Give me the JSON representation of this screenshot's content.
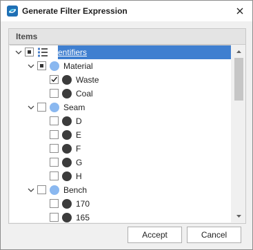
{
  "window": {
    "title": "Generate Filter Expression"
  },
  "group": {
    "title": "Items"
  },
  "tree": {
    "items": [
      {
        "label": "Identifiers",
        "level": 0,
        "expanded": true,
        "check": "indeterminate",
        "icon": "list-icon",
        "selected": true
      },
      {
        "label": "Material",
        "level": 1,
        "expanded": true,
        "check": "indeterminate",
        "icon": "blue-circle"
      },
      {
        "label": "Waste",
        "level": 2,
        "check": "checked",
        "icon": "dark-circle"
      },
      {
        "label": "Coal",
        "level": 2,
        "check": "unchecked",
        "icon": "dark-circle"
      },
      {
        "label": "Seam",
        "level": 1,
        "expanded": true,
        "check": "unchecked",
        "icon": "blue-circle"
      },
      {
        "label": "D",
        "level": 2,
        "check": "unchecked",
        "icon": "dark-circle"
      },
      {
        "label": "E",
        "level": 2,
        "check": "unchecked",
        "icon": "dark-circle"
      },
      {
        "label": "F",
        "level": 2,
        "check": "unchecked",
        "icon": "dark-circle"
      },
      {
        "label": "G",
        "level": 2,
        "check": "unchecked",
        "icon": "dark-circle"
      },
      {
        "label": "H",
        "level": 2,
        "check": "unchecked",
        "icon": "dark-circle"
      },
      {
        "label": "Bench",
        "level": 1,
        "expanded": true,
        "check": "unchecked",
        "icon": "blue-circle"
      },
      {
        "label": "170",
        "level": 2,
        "check": "unchecked",
        "icon": "dark-circle"
      },
      {
        "label": "165",
        "level": 2,
        "check": "unchecked",
        "icon": "dark-circle"
      }
    ]
  },
  "buttons": {
    "accept": "Accept",
    "cancel": "Cancel"
  },
  "colors": {
    "selection": "#3f7fd0",
    "category_icon": "#8ab8f0",
    "leaf_icon": "#3c3c3c"
  }
}
